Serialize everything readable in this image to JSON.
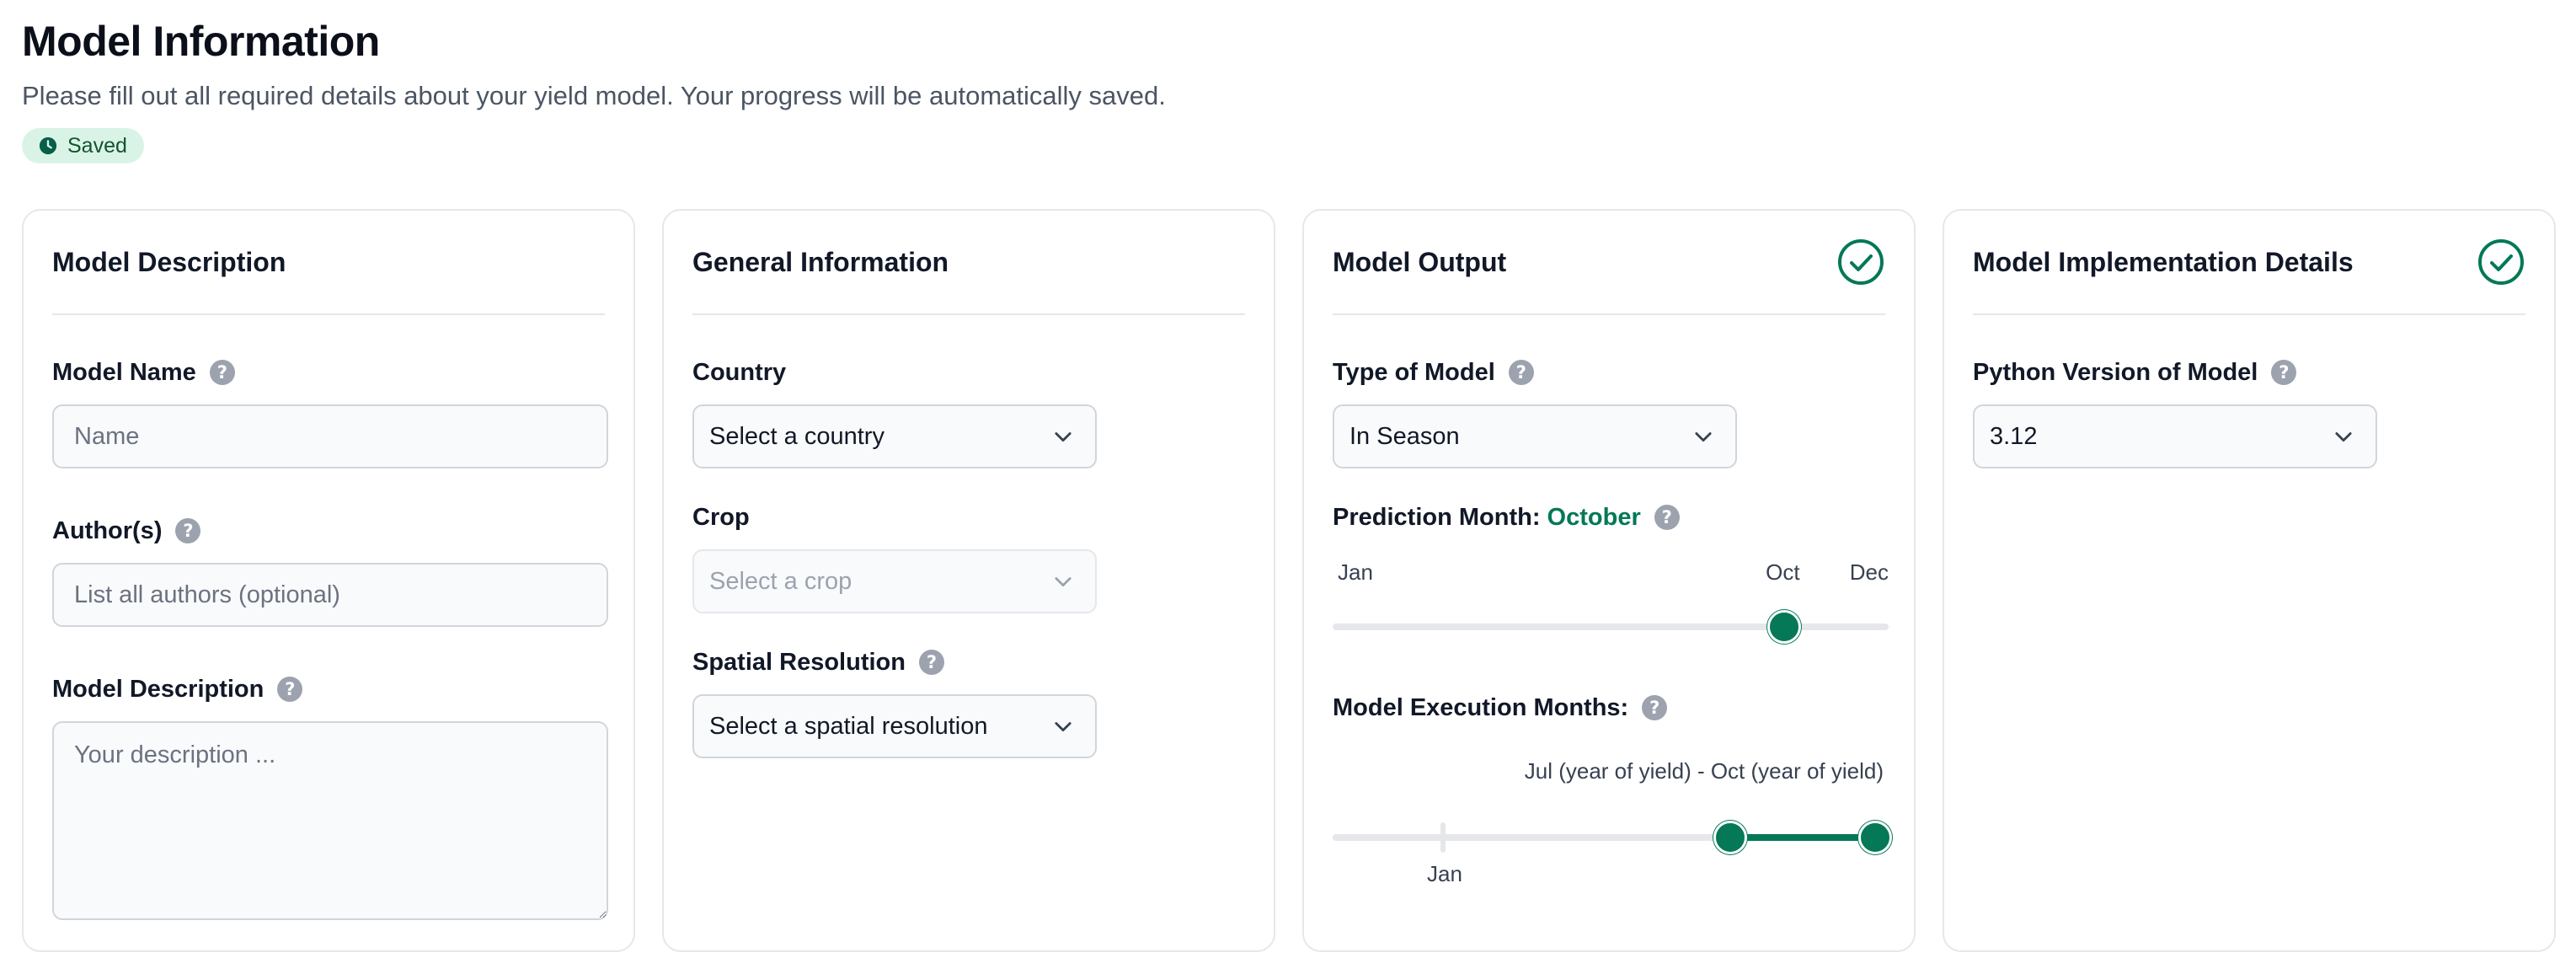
{
  "page": {
    "title": "Model Information",
    "subtitle": "Please fill out all required details about your yield model. Your progress will be automatically saved.",
    "status": "Saved",
    "accent_color": "#047857"
  },
  "description_card": {
    "title": "Model Description",
    "name": {
      "label": "Model Name",
      "placeholder": "Name",
      "value": ""
    },
    "authors": {
      "label": "Author(s)",
      "placeholder": "List all authors (optional)",
      "value": ""
    },
    "description": {
      "label": "Model Description",
      "placeholder": "Your description ...",
      "value": ""
    }
  },
  "general_card": {
    "title": "General Information",
    "country": {
      "label": "Country",
      "value": "Select a country"
    },
    "crop": {
      "label": "Crop",
      "value": "Select a crop",
      "disabled": true
    },
    "spatial": {
      "label": "Spatial Resolution",
      "value": "Select a spatial resolution"
    }
  },
  "output_card": {
    "title": "Model Output",
    "complete": true,
    "model_type": {
      "label": "Type of Model",
      "value": "In Season"
    },
    "prediction_month": {
      "label": "Prediction Month:",
      "value": "October",
      "min_label": "Jan",
      "max_label": "Dec",
      "current_label": "Oct",
      "month_index": 10
    },
    "execution_months": {
      "label": "Model Execution Months:",
      "range_text": "Jul (year of yield) - Oct (year of yield)",
      "tick_label": "Jan",
      "start_fraction": 0.715,
      "end_fraction": 0.975
    }
  },
  "implementation_card": {
    "title": "Model Implementation Details",
    "complete": true,
    "python_version": {
      "label": "Python Version of Model",
      "value": "3.12"
    }
  },
  "icons": [
    "clock-icon",
    "check-circle-icon",
    "help-icon",
    "chevron-down-icon"
  ]
}
